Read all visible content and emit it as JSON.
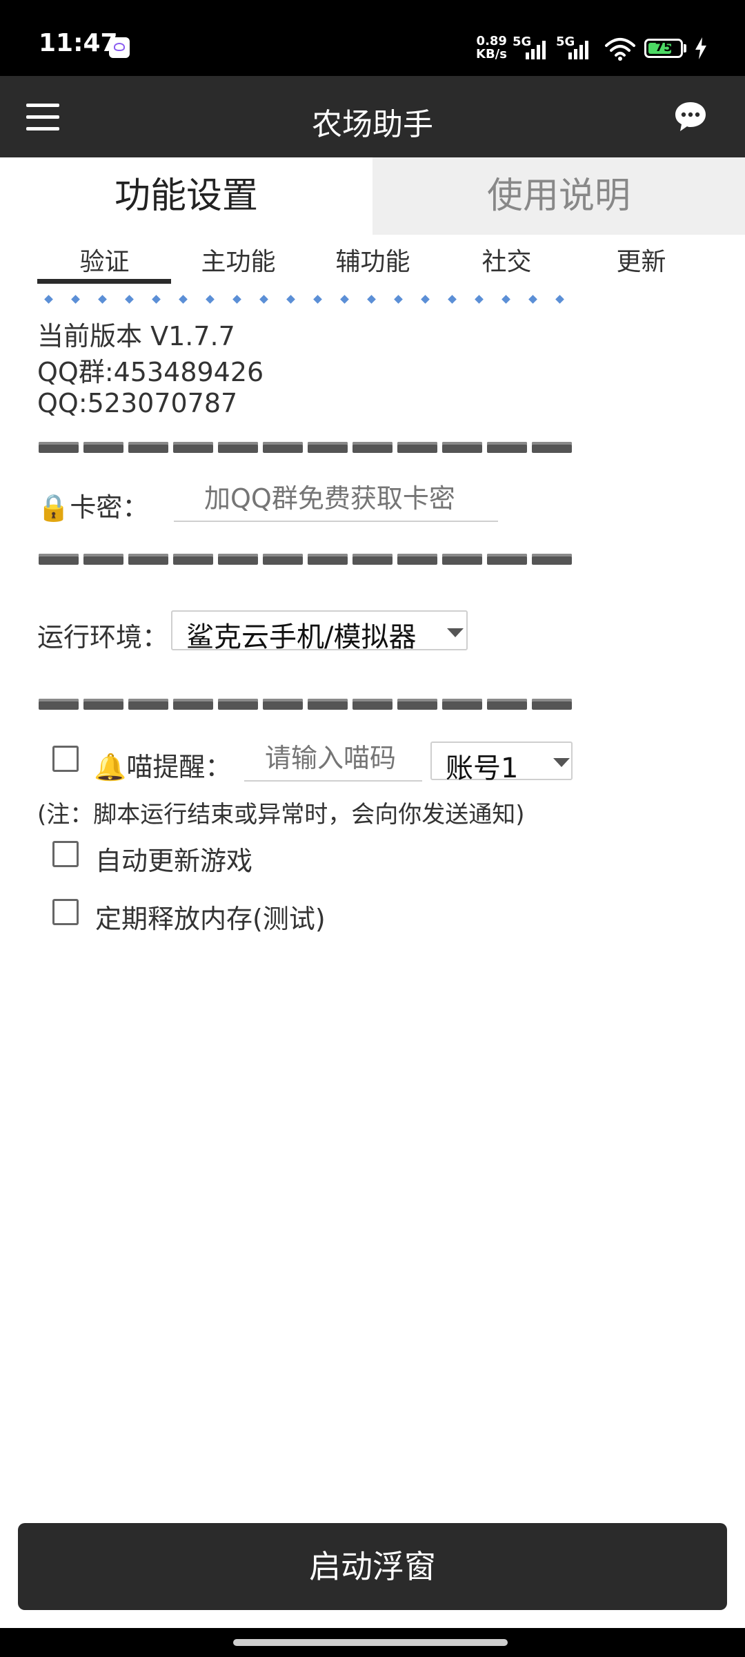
{
  "status_bar": {
    "time": "11:47",
    "speed_value": "0.89",
    "speed_unit": "KB/s",
    "net1": "5G",
    "net2": "5G",
    "battery": "75",
    "battery_level": 0.75
  },
  "app_bar": {
    "title": "农场助手"
  },
  "main_tabs": [
    {
      "label": "功能设置",
      "active": true
    },
    {
      "label": "使用说明",
      "active": false
    }
  ],
  "sub_tabs": [
    {
      "label": "验证",
      "active": true
    },
    {
      "label": "主功能"
    },
    {
      "label": "辅功能"
    },
    {
      "label": "社交"
    },
    {
      "label": "更新"
    }
  ],
  "info": {
    "version": "当前版本 V1.7.7",
    "qq_group": "QQ群:453489426",
    "qq": "QQ:523070787"
  },
  "card": {
    "label": "🔒卡密：",
    "placeholder": "加QQ群免费获取卡密"
  },
  "env": {
    "label": "运行环境：",
    "selected": "鲨克云手机/模拟器"
  },
  "meow": {
    "label": "🔔喵提醒：",
    "placeholder": "请输入喵码",
    "account": "账号1",
    "note": "(注：脚本运行结束或异常时，会向你发送通知)"
  },
  "options": {
    "auto_update": "自动更新游戏",
    "release_memory": "定期释放内存(测试)"
  },
  "launch_label": "启动浮窗",
  "colors": {
    "accent": "#2b2b2b",
    "dot_blue": "#5b8fd6",
    "battery_green": "#4cd964"
  }
}
